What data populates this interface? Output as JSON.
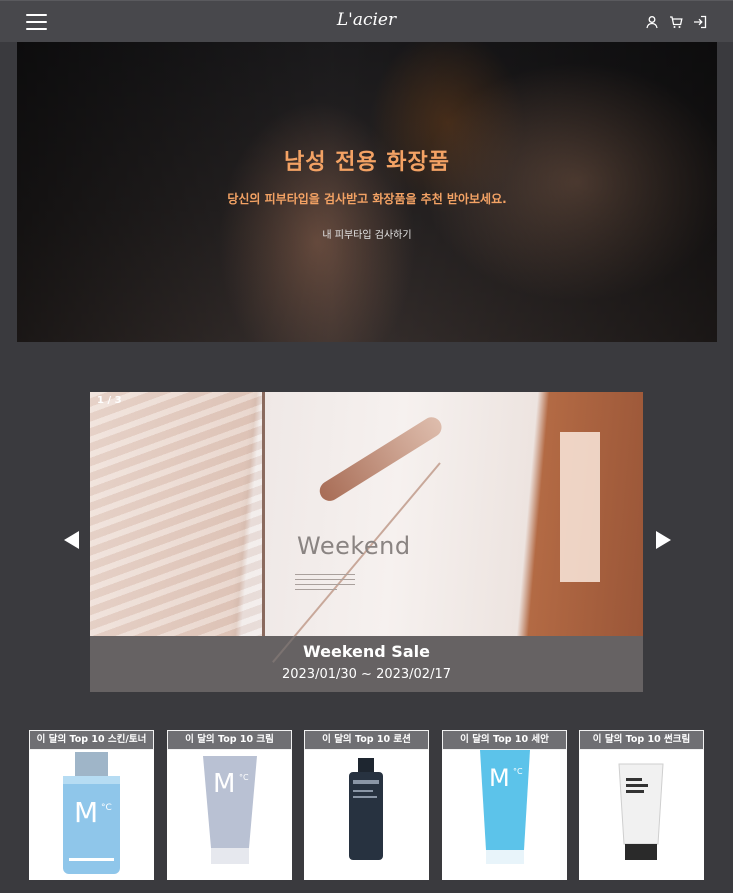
{
  "header": {
    "logo": "L'acier",
    "icons": [
      "hamburger-menu-icon",
      "user-icon",
      "cart-icon",
      "login-icon"
    ]
  },
  "hero": {
    "title": "남성 전용 화장품",
    "subtitle": "당신의 피부타입을 검사받고 화장품을 추천 받아보세요.",
    "link": "내 피부타입 검사하기",
    "accent": "#f3a264"
  },
  "slider": {
    "counter": "1 / 3",
    "word": "Weekend",
    "caption_title": "Weekend Sale",
    "caption_date": "2023/01/30 ~ 2023/02/17"
  },
  "products": [
    {
      "label": "이 달의 Top 10 스킨/토너"
    },
    {
      "label": "이 달의 Top 10 크림"
    },
    {
      "label": "이 달의 Top 10 로션"
    },
    {
      "label": "이 달의 Top 10 세안"
    },
    {
      "label": "이 달의 Top 10 썬크림"
    }
  ],
  "colors": {
    "background": "#3a3a3e",
    "topbar": "#48484c",
    "label_bg": "#6f6f73"
  }
}
